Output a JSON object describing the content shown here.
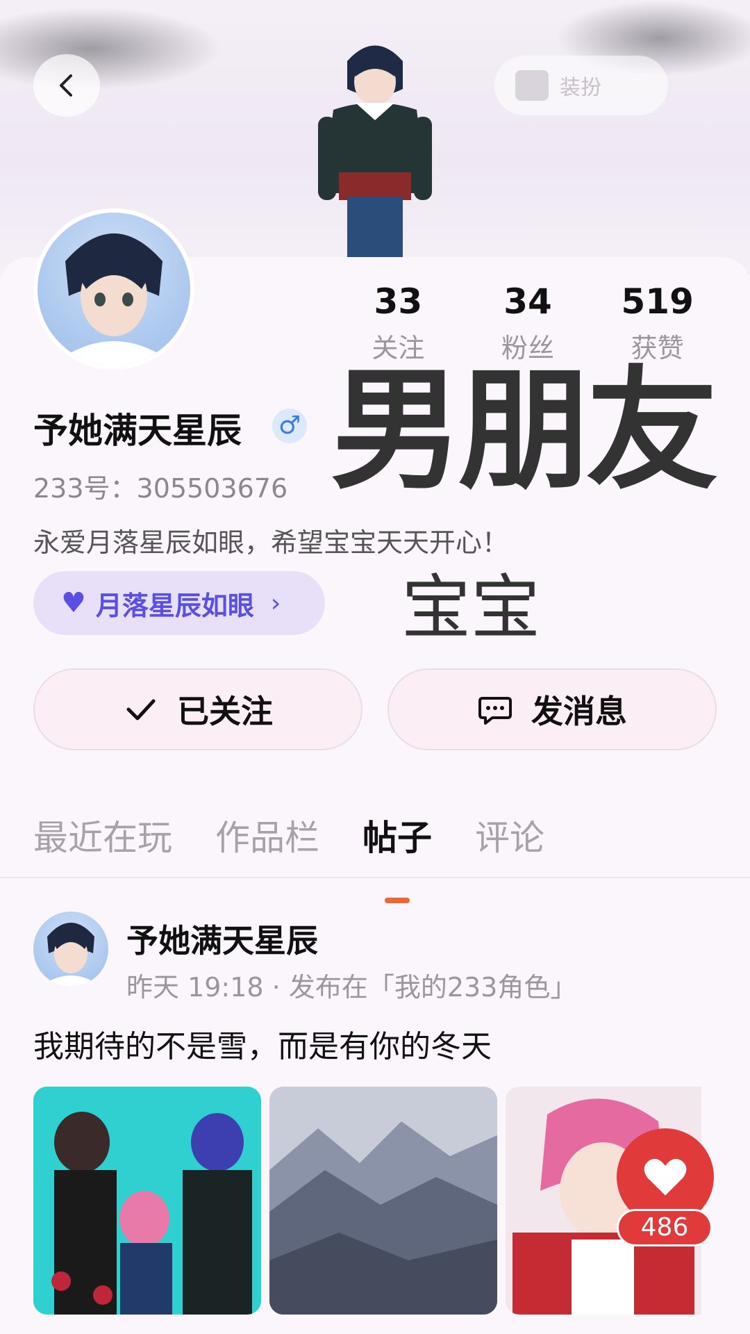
{
  "header": {
    "dress_label": "装扮"
  },
  "profile": {
    "username": "予她满天星辰",
    "gender_symbol": "♂",
    "uid": "233号：305503676",
    "bio": "永爱月落星辰如眼，希望宝宝天天开心！",
    "relation_label": "月落星辰如眼",
    "overlay_big": "男朋友",
    "overlay_small": "宝宝"
  },
  "stats": [
    {
      "num": "33",
      "label": "关注"
    },
    {
      "num": "34",
      "label": "粉丝"
    },
    {
      "num": "519",
      "label": "获赞"
    }
  ],
  "actions": {
    "follow_label": "已关注",
    "message_label": "发消息"
  },
  "tabs": [
    {
      "label": "最近在玩"
    },
    {
      "label": "作品栏"
    },
    {
      "label": "帖子"
    },
    {
      "label": "评论"
    }
  ],
  "post": {
    "author": "予她满天星辰",
    "meta": "昨天 19:18 · 发布在「我的233角色」",
    "text": "我期待的不是雪，而是有你的冬天",
    "like_count": "486"
  },
  "colors": {
    "accent": "#e8683c",
    "relation": "#5a4fe0",
    "like": "#e03a3a"
  }
}
